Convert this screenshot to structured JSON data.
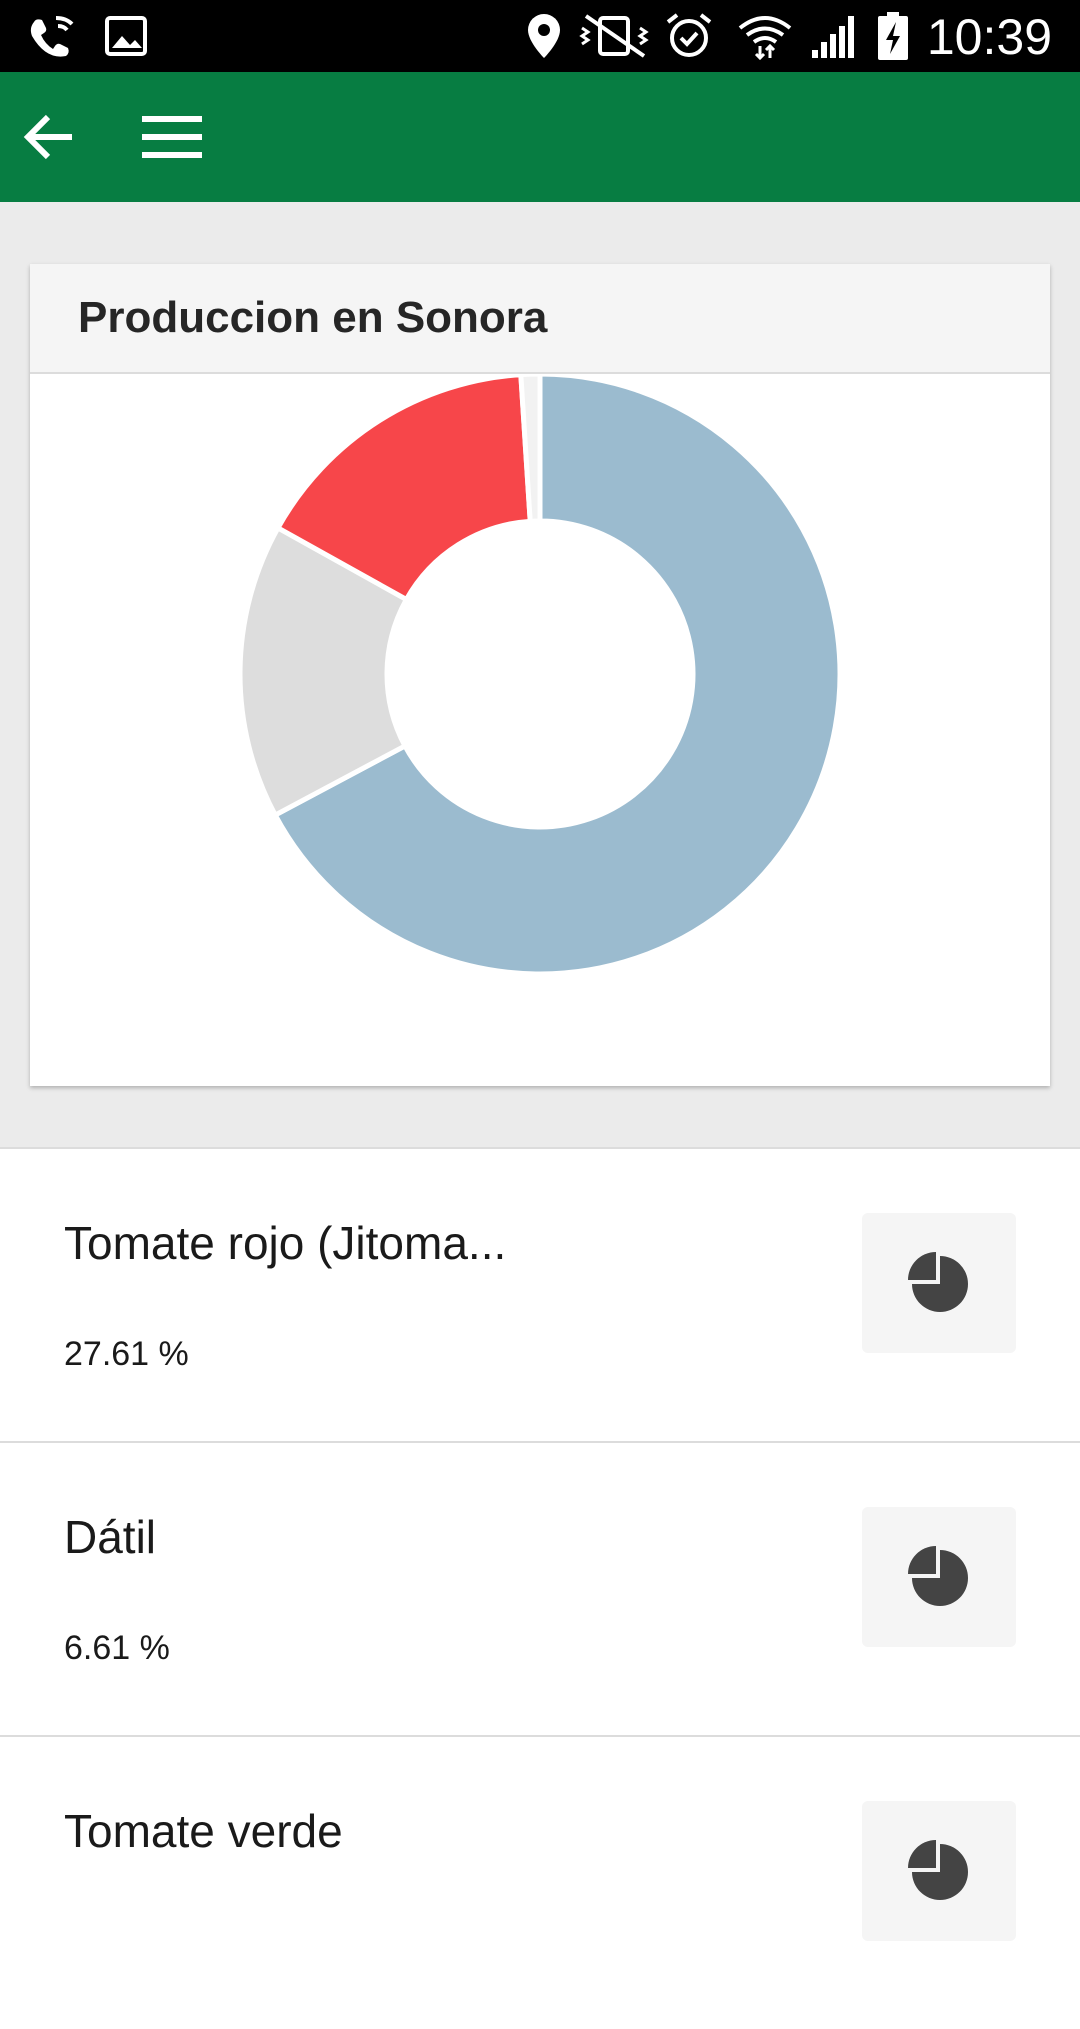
{
  "status_bar": {
    "time": "10:39",
    "icons": [
      "wifi-call-icon",
      "image-icon",
      "location-icon",
      "vibrate-icon",
      "alarm-icon",
      "wifi-icon",
      "signal-icon",
      "battery-charging-icon"
    ]
  },
  "app_bar": {
    "color": "#077d42",
    "icons": [
      "back-arrow-icon",
      "menu-icon"
    ]
  },
  "card": {
    "title": "Produccion en Sonora"
  },
  "chart_data": {
    "type": "pie",
    "values": [
      66.0,
      15.6,
      15.6,
      1.0
    ],
    "colors": [
      "#9bbbcf",
      "#dddddd",
      "#f7464a",
      "#f2f2f2"
    ]
  },
  "list": {
    "items": [
      {
        "name": "Tomate rojo (Jitoma...",
        "percent": "27.61 %"
      },
      {
        "name": "Dátil",
        "percent": "6.61 %"
      },
      {
        "name": "Tomate verde",
        "percent": ""
      }
    ],
    "button_icon": "pie-chart-icon"
  }
}
